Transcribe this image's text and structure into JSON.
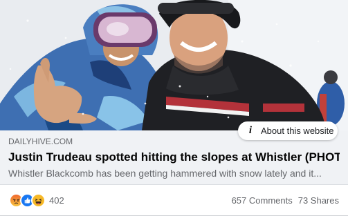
{
  "link_preview": {
    "photo_icon": "ski-selfie-photo",
    "about_label": "About this website",
    "about_icon": "info-icon",
    "domain": "DAILYHIVE.COM",
    "headline": "Justin Trudeau spotted hitting the slopes at Whistler (PHOTO)",
    "summary": "Whistler Blackcomb has been getting hammered with snow lately and it..."
  },
  "engagement": {
    "reactions": [
      {
        "icon": "angry-reaction-icon",
        "color": "#f0692f"
      },
      {
        "icon": "like-reaction-icon",
        "color": "#1877f2"
      },
      {
        "icon": "haha-reaction-icon",
        "color": "#f7b928"
      }
    ],
    "reaction_count": "402",
    "comments": "657 Comments",
    "shares": "73 Shares"
  },
  "colors": {
    "meta_background": "#f0f2f5",
    "secondary_text": "#65676b",
    "headline_text": "#050505",
    "pill_background": "#ffffff"
  }
}
